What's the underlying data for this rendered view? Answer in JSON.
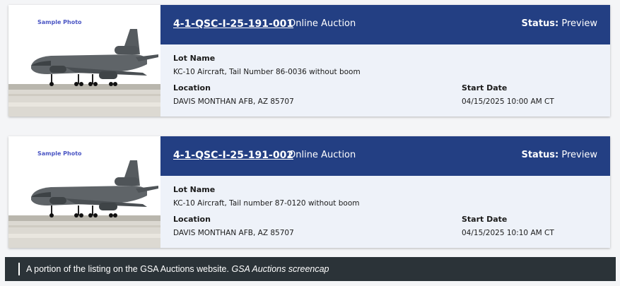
{
  "listings": [
    {
      "photo_label": "Sample Photo",
      "lot_number": "4-1-QSC-I-25-191-001",
      "auction_type": "Online Auction",
      "status_label": "Status:",
      "status_value": "Preview",
      "lot_name_label": "Lot Name",
      "lot_name": "KC-10 Aircraft, Tail Number 86-0036 without boom",
      "location_label": "Location",
      "location": "DAVIS MONTHAN AFB, AZ 85707",
      "start_date_label": "Start Date",
      "start_date": "04/15/2025 10:00 AM CT"
    },
    {
      "photo_label": "Sample Photo",
      "lot_number": "4-1-QSC-I-25-191-002",
      "auction_type": "Online Auction",
      "status_label": "Status:",
      "status_value": "Preview",
      "lot_name_label": "Lot Name",
      "lot_name": "KC-10 Aircraft, Tail number 87-0120 without boom",
      "location_label": "Location",
      "location": "DAVIS MONTHAN AFB, AZ 85707",
      "start_date_label": "Start Date",
      "start_date": "04/15/2025 10:10 AM CT"
    }
  ],
  "caption": {
    "text": "A portion of the listing on the GSA Auctions website.",
    "credit": "GSA Auctions screencap"
  },
  "colors": {
    "header_bg": "#233f83",
    "card_bg": "#eef2f9",
    "caption_bg": "#2b3338",
    "photo_label": "#4a55c4"
  },
  "icons": {
    "photo": "kc10-aircraft-photo"
  }
}
